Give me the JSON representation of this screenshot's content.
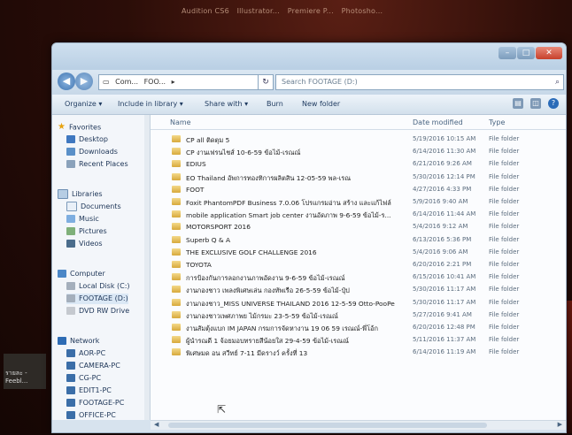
{
  "taskbar": {
    "apps": [
      "Audition CS6",
      "Illustrator...",
      "Premiere P...",
      "Photosho..."
    ]
  },
  "desktop": {
    "left_label_1": "รายละ -",
    "left_label_2": "Feebl..."
  },
  "address": {
    "crumbs": [
      "Com...",
      "FOO...",
      "▸"
    ],
    "search_placeholder": "Search FOOTAGE (D:)"
  },
  "toolbar": {
    "organize": "Organize ▾",
    "include": "Include in library ▾",
    "share": "Share with ▾",
    "burn": "Burn",
    "new_folder": "New folder"
  },
  "nav": {
    "favorites": "Favorites",
    "desktop": "Desktop",
    "downloads": "Downloads",
    "recent": "Recent Places",
    "libraries": "Libraries",
    "documents": "Documents",
    "music": "Music",
    "pictures": "Pictures",
    "videos": "Videos",
    "computer": "Computer",
    "local_disk": "Local Disk (C:)",
    "footage": "FOOTAGE (D:)",
    "dvd": "DVD RW Drive",
    "network": "Network",
    "pcs": [
      "AOR-PC",
      "CAMERA-PC",
      "CG-PC",
      "EDIT1-PC",
      "FOOTAGE-PC",
      "OFFICE-PC"
    ]
  },
  "columns": {
    "name": "Name",
    "date": "Date modified",
    "type": "Type"
  },
  "files": [
    {
      "name": "CP all ติดตุม 5",
      "date": "5/19/2016 10:15 AM",
      "type": "File folder"
    },
    {
      "name": "CP งานเฟรนไชส์ 10-6-59 ข้อไม้-เรณณ์",
      "date": "6/14/2016 11:30 AM",
      "type": "File folder"
    },
    {
      "name": "EDIUS",
      "date": "6/21/2016 9:26 AM",
      "type": "File folder"
    },
    {
      "name": "EO Thailand อัพการทองทิการผลิตสิน 12-05-59 พล-เรณ",
      "date": "5/30/2016 12:14 PM",
      "type": "File folder"
    },
    {
      "name": "FOOT",
      "date": "4/27/2016 4:33 PM",
      "type": "File folder"
    },
    {
      "name": "Foxit PhantomPDF Business 7.0.06 โปรแกรมอ่าน สร้าง และแก้ไฟล์",
      "date": "5/9/2016 9:40 AM",
      "type": "File folder"
    },
    {
      "name": "mobile application Smart job center งานอัดภาพ 9-6-59 ข้อไม้-ร...",
      "date": "6/14/2016 11:44 AM",
      "type": "File folder"
    },
    {
      "name": "MOTORSPORT 2016",
      "date": "5/4/2016 9:12 AM",
      "type": "File folder"
    },
    {
      "name": "Superb Q & A",
      "date": "6/13/2016 5:36 PM",
      "type": "File folder"
    },
    {
      "name": "THE EXCLUSIVE GOLF CHALLENGE 2016",
      "date": "5/4/2016 9:06 AM",
      "type": "File folder"
    },
    {
      "name": "TOYOTA",
      "date": "6/20/2016 2:21 PM",
      "type": "File folder"
    },
    {
      "name": "การป้องกันการลอกงานภาพอัดงาน 9-6-59 ข้อไม้-เรณณ์",
      "date": "6/15/2016 10:41 AM",
      "type": "File folder"
    },
    {
      "name": "งานกองชาว เพลงพิเศษเล่น กองทัพเรือ 26-5-59 ข้อไม้-ปุ๋ป",
      "date": "5/30/2016 11:17 AM",
      "type": "File folder"
    },
    {
      "name": "งานกองชาว_MISS UNIVERSE THAILAND 2016 12-5-59 Otto-PooPe",
      "date": "5/30/2016 11:17 AM",
      "type": "File folder"
    },
    {
      "name": "งานกองชาวเพศภาพย ไม้กรมะ 23-5-59 ข้อไม้-เรณณ์",
      "date": "5/27/2016 9:41 AM",
      "type": "File folder"
    },
    {
      "name": "งานสัมตุ้งแบก IM JAPAN กรมการจัดหางาน 19 06 59 เรณณ์-พี่โอ้ก",
      "date": "6/20/2016 12:48 PM",
      "type": "File folder"
    },
    {
      "name": "ผู้นำรณดี 1 จ้อยมอบทรายสีน้อยใส 29-4-59 ข้อไม้-เรณณ์",
      "date": "5/11/2016 11:37 AM",
      "type": "File folder"
    },
    {
      "name": "พิเศษมด อน สวีทย์ 7-11 มีดรางว์ ครั้งที่ 13",
      "date": "6/14/2016 11:19 AM",
      "type": "File folder"
    }
  ]
}
